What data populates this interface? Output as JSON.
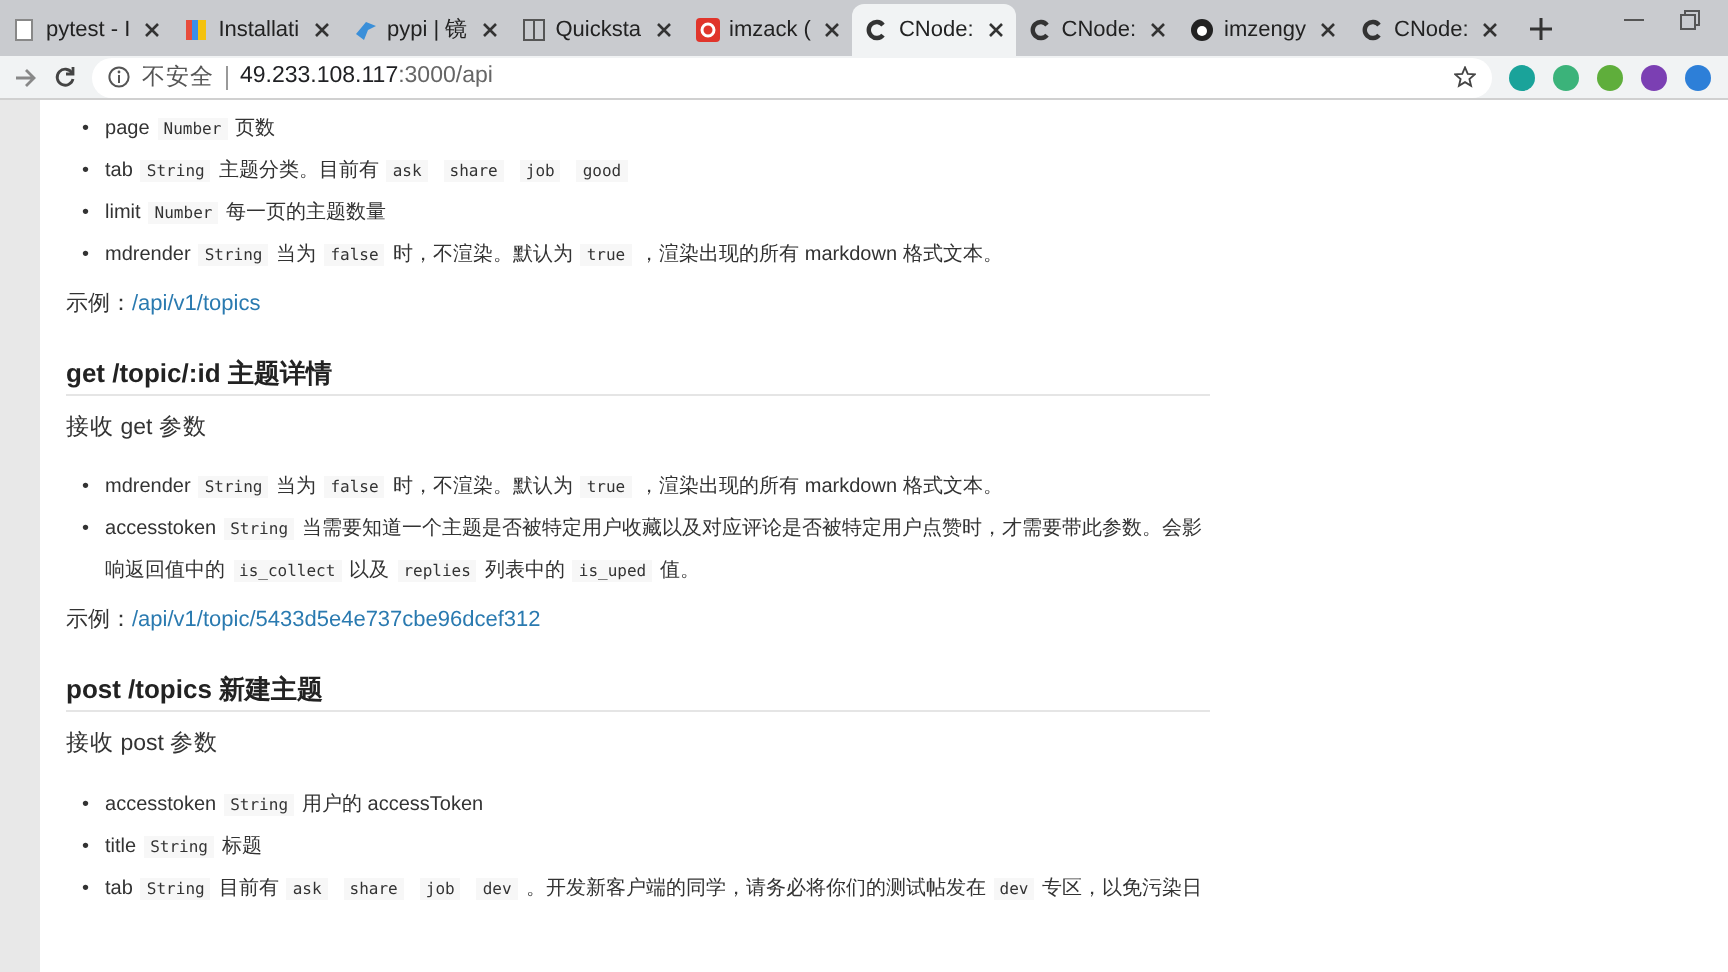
{
  "tabs": [
    {
      "title": "pytest - I",
      "kind": "page",
      "selected": false
    },
    {
      "title": "Installati",
      "kind": "flag",
      "selected": false
    },
    {
      "title": "pypi | 镜",
      "kind": "bird",
      "selected": false
    },
    {
      "title": "Quicksta",
      "kind": "book",
      "selected": false
    },
    {
      "title": "imzack (",
      "kind": "g",
      "selected": false
    },
    {
      "title": "CNode:",
      "kind": "c",
      "selected": true
    },
    {
      "title": "CNode:",
      "kind": "c",
      "selected": false
    },
    {
      "title": "imzengy",
      "kind": "octo",
      "selected": false
    },
    {
      "title": "CNode:",
      "kind": "c",
      "selected": false
    }
  ],
  "address": {
    "security": "不安全",
    "host": "49.233.108.117",
    "path": ":3000/api"
  },
  "content": [
    {
      "kind": "list",
      "items": [
        {
          "marker": "•",
          "parts": [
            {
              "kind": "text",
              "text": "page"
            },
            {
              "kind": "code",
              "text": "Number"
            },
            {
              "kind": "text",
              "text": "页数"
            }
          ]
        },
        {
          "marker": "•",
          "parts": [
            {
              "kind": "text",
              "text": "tab"
            },
            {
              "kind": "code",
              "text": "String"
            },
            {
              "kind": "text",
              "text": "主题分类。目前有"
            },
            {
              "kind": "code",
              "text": "ask"
            },
            {
              "kind": "code",
              "text": "share"
            },
            {
              "kind": "code",
              "text": "job"
            },
            {
              "kind": "code",
              "text": "good"
            }
          ]
        },
        {
          "marker": "•",
          "parts": [
            {
              "kind": "text",
              "text": "limit"
            },
            {
              "kind": "code",
              "text": "Number"
            },
            {
              "kind": "text",
              "text": "每一页的主题数量"
            }
          ]
        },
        {
          "marker": "•",
          "parts": [
            {
              "kind": "text",
              "text": "mdrender"
            },
            {
              "kind": "code",
              "text": "String"
            },
            {
              "kind": "text",
              "text": "当为"
            },
            {
              "kind": "code",
              "text": "false"
            },
            {
              "kind": "text",
              "text": "时，不渲染。默认为"
            },
            {
              "kind": "code",
              "text": "true"
            },
            {
              "kind": "text",
              "text": "，渲染出现的所有 markdown 格式文本。"
            }
          ]
        }
      ]
    },
    {
      "kind": "example",
      "label": "示例：",
      "link": "/api/v1/topics"
    },
    {
      "kind": "heading",
      "text": "get /topic/:id 主题详情"
    },
    {
      "kind": "para",
      "text": "接收 get 参数"
    },
    {
      "kind": "list",
      "items": [
        {
          "marker": "•",
          "parts": [
            {
              "kind": "text",
              "text": "mdrender"
            },
            {
              "kind": "code",
              "text": "String"
            },
            {
              "kind": "text",
              "text": "当为"
            },
            {
              "kind": "code",
              "text": "false"
            },
            {
              "kind": "text",
              "text": "时，不渲染。默认为"
            },
            {
              "kind": "code",
              "text": "true"
            },
            {
              "kind": "text",
              "text": "，渲染出现的所有 markdown 格式文本。"
            }
          ]
        },
        {
          "marker": "•",
          "parts": [
            {
              "kind": "text",
              "text": "accesstoken"
            },
            {
              "kind": "code",
              "text": "String"
            },
            {
              "kind": "text",
              "text": "当需要知道一个主题是否被特定用户收藏以及对应评论是否被特定用户点赞时，才需要带此参数。会影响返回值中的"
            },
            {
              "kind": "code",
              "text": "is_collect"
            },
            {
              "kind": "text",
              "text": "以及"
            },
            {
              "kind": "code",
              "text": "replies"
            },
            {
              "kind": "text",
              "text": "列表中的"
            },
            {
              "kind": "code",
              "text": "is_uped"
            },
            {
              "kind": "text",
              "text": "值。"
            }
          ]
        }
      ]
    },
    {
      "kind": "example",
      "label": "示例：",
      "link": "/api/v1/topic/5433d5e4e737cbe96dcef312"
    },
    {
      "kind": "heading",
      "text": "post /topics 新建主题"
    },
    {
      "kind": "para",
      "text": "接收 post 参数"
    },
    {
      "kind": "list",
      "items": [
        {
          "marker": "•",
          "parts": [
            {
              "kind": "text",
              "text": "accesstoken"
            },
            {
              "kind": "code",
              "text": "String"
            },
            {
              "kind": "text",
              "text": "用户的 accessToken"
            }
          ]
        },
        {
          "marker": "•",
          "parts": [
            {
              "kind": "text",
              "text": "title"
            },
            {
              "kind": "code",
              "text": "String"
            },
            {
              "kind": "text",
              "text": "标题"
            }
          ]
        },
        {
          "marker": "•",
          "parts": [
            {
              "kind": "text",
              "text": "tab"
            },
            {
              "kind": "code",
              "text": "String"
            },
            {
              "kind": "text",
              "text": "目前有"
            },
            {
              "kind": "code",
              "text": "ask"
            },
            {
              "kind": "code",
              "text": "share"
            },
            {
              "kind": "code",
              "text": "job"
            },
            {
              "kind": "code",
              "text": "dev"
            },
            {
              "kind": "text",
              "text": "。开发新客户端的同学，请务必将你们的测试帖发在"
            },
            {
              "kind": "code",
              "text": "dev"
            },
            {
              "kind": "text",
              "text": "专区，以免污染日"
            }
          ]
        }
      ]
    }
  ]
}
